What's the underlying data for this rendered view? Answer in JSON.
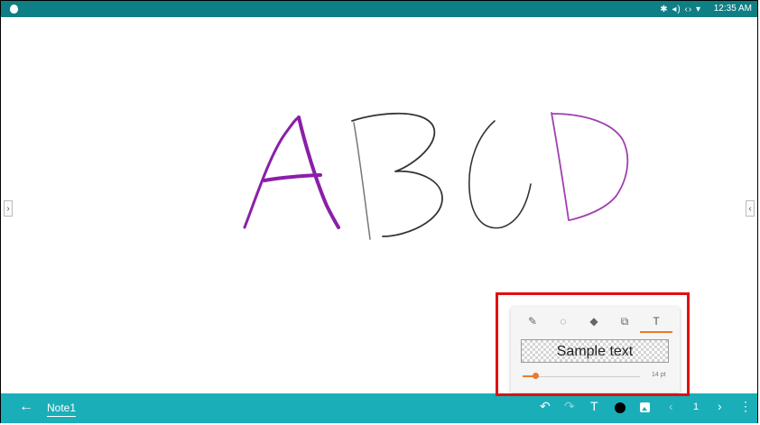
{
  "status_bar": {
    "time": "12:35 AM",
    "icons": [
      "bluetooth-icon",
      "volume-icon",
      "wifi-icon"
    ],
    "icons_text": "✱ ◂) ‹› ▾"
  },
  "drawing": {
    "letters": [
      "A",
      "B",
      "C",
      "D"
    ],
    "stroke_colors": {
      "A": "#8b1fa8",
      "B": "#333333",
      "C": "#333333",
      "D": "#a040b0"
    }
  },
  "edge_tabs": {
    "left": "›",
    "right": "‹"
  },
  "toolbar": {
    "back_icon": "←",
    "note_title": "Note1",
    "undo_icon": "↶",
    "redo_icon": "↷",
    "text_icon": "T",
    "current_color": "#000000",
    "prev_page_icon": "‹",
    "page_number": "1",
    "next_page_icon": "›",
    "more_icon": "⋮",
    "brand_color": "#1aaeb8"
  },
  "text_panel": {
    "tools": [
      {
        "name": "pen-tool",
        "glyph": "✎"
      },
      {
        "name": "lasso-tool",
        "glyph": "◌"
      },
      {
        "name": "eraser-tool",
        "glyph": "◆"
      },
      {
        "name": "shape-tool",
        "glyph": "⧉"
      },
      {
        "name": "text-tool",
        "glyph": "T"
      }
    ],
    "active_tool": "text-tool",
    "sample_text": "Sample text",
    "font_size_label": "14 pt",
    "font_size_value": 14,
    "accent_color": "#e87a2e"
  },
  "highlight_color": "#e01010"
}
